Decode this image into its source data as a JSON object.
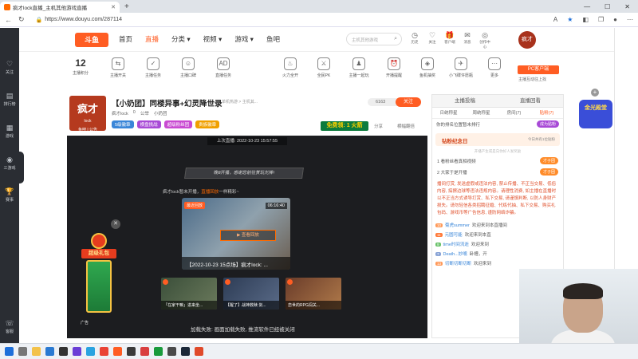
{
  "browser": {
    "tab_title": "疯才lock直播_主机其他游戏直播",
    "url": "https://www.douyu.com/287114"
  },
  "leftbar": [
    {
      "label": "关注",
      "icon": "heart-icon"
    },
    {
      "label": "排行榜",
      "icon": "ranking-icon"
    },
    {
      "label": "游戏",
      "icon": "game-icon"
    },
    {
      "label": "三游戏",
      "icon": "controller-icon"
    },
    {
      "label": "赛事",
      "icon": "trophy-icon"
    },
    {
      "label": "客服",
      "icon": "headset-icon"
    }
  ],
  "header": {
    "logo": "斗鱼",
    "nav": [
      "首页",
      "直播",
      "分类 ▾",
      "视频 ▾",
      "游戏 ▾",
      "鱼吧"
    ],
    "search_placeholder": "主机其他游戏",
    "icons": [
      {
        "label": "历史",
        "icon": "history-icon"
      },
      {
        "label": "关注",
        "icon": "heart-icon"
      },
      {
        "label": "客户端",
        "icon": "gift-icon"
      },
      {
        "label": "消息",
        "icon": "message-icon"
      },
      {
        "label": "创作中心",
        "icon": "create-icon"
      }
    ],
    "avatar_text": "疯才"
  },
  "quickbar": {
    "level": "12",
    "level_label": "主播积分",
    "items": [
      "主播开关",
      "主播任务",
      "主播口碑",
      "直播任务",
      "火力全开",
      "全民PK",
      "主播一起玩",
      "开播提醒",
      "鱼机抽奖",
      "小飞碟许愿瓶",
      "更多"
    ],
    "pc_button": "PC客户端",
    "pc_sub": "主播互动往上找"
  },
  "room": {
    "avatar_text": "疯才",
    "avatar_sub": "lock",
    "avatar_footer": "鱼吧 | 公告",
    "title": "【小奶团】同楼异事+幻灵降世录",
    "category": "单机热游 > 主机其...",
    "host": "疯才lock",
    "heat": "0",
    "report_label": "公举",
    "tag": "小奶团",
    "badges": [
      "5级徽章",
      "横盘挑战",
      "超级粉丝团",
      "贵族徽章"
    ],
    "fans": "6163",
    "follow": "关注",
    "free_gift": "免费领: 1 火箭",
    "share": "分享",
    "report": "横幅翻倍"
  },
  "player": {
    "last_live": "上次直播: 2022-10-23 15:57:55",
    "notice": "晚8开播，感谢您前往赏玩光棒!",
    "notice_line_a": "疯才lock暂未开播，",
    "notice_line_hl": "直播回放",
    "notice_line_b": "一样精彩~",
    "replay_tag": "最近回放",
    "replay_duration": "06:16:40",
    "replay_button": "▶ 查看回放",
    "replay_title": "【2022-10-23 15点场】疯才lock: ...",
    "thumbs": [
      "「在家干嘛」进来坐...",
      "【醒了】战神救赎 剑...",
      "恋世的RPG闯关..."
    ],
    "load_fail": "加载失败: 画面加载失败, 推流软件已经被关闭",
    "ad_title": "超级礼包",
    "ad_label": "广告"
  },
  "chat": {
    "tabs": [
      "主播投稿",
      "直播回看",
      ""
    ],
    "subtabs": [
      "日统称星",
      "周统称星",
      "房间(7)",
      "贴粉(7)"
    ],
    "rank_text": "你的排名位置暂未排行",
    "become_fan": "成为贴粉",
    "diamond_title": "钻粉纪念日",
    "diamond_today": "今日共有1位贴粉",
    "hint": "开播产生或是向你好人发奖励",
    "tasks": [
      {
        "n": "1",
        "text": "看粉丝看真相视频",
        "go": "才子团"
      },
      {
        "n": "2",
        "text": "大家于是开播",
        "go": "才子团"
      }
    ],
    "rules": "播间打赏, 发送虚假或违法内容, 禁止传播、不正当交易、低俗内容, 搞擦边球等违法违规内容。请理性消费, 如主播在直播时以不正当方式诱导打赏、私下交易, 请谨慎判断, 以防人身财产损失。请勿轻信各类招聘征婚、代练代抽、私下交易、购买礼包码、游戏币等广告信息, 谨防网络诈骗。",
    "messages": [
      {
        "lv": "10",
        "name": "菊虎summer",
        "text": "欢迎来到本直播间"
      },
      {
        "lv": "11",
        "name": "元圆可能",
        "text": "欢迎来到本直"
      },
      {
        "lv": "9",
        "name": "time时间流逝",
        "text": "欢迎来到"
      },
      {
        "lv": "7",
        "name": "Death...妙嘴",
        "text": "卧槽，开"
      },
      {
        "lv": "13",
        "name": "切断切断切断",
        "text": "欢迎来到"
      }
    ]
  },
  "right_promo": "金光殿堂",
  "colors": {
    "accent": "#ff5d23",
    "dark_panel": "#1c1d20"
  }
}
